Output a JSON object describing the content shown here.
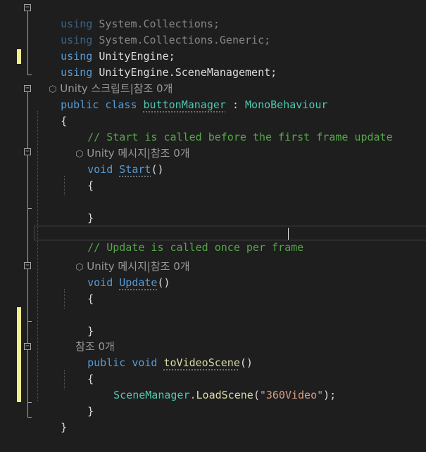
{
  "editor": {
    "lines": {
      "l1": {
        "kw": "using",
        "ns1": "System",
        "dot1": ".",
        "ns2": "Collections",
        "semi": ";"
      },
      "l2": {
        "kw": "using",
        "ns1": "System",
        "dot1": ".",
        "ns2": "Collections",
        "dot2": ".",
        "ns3": "Generic",
        "semi": ";"
      },
      "l3": {
        "kw": "using",
        "ns1": "UnityEngine",
        "semi": ";"
      },
      "l4": {
        "kw": "using",
        "ns1": "UnityEngine",
        "dot1": ".",
        "ns2": "SceneManagement",
        "semi": ";"
      },
      "l5": {
        "lens": "Unity 스크립트|참조 0개"
      },
      "l6": {
        "kw1": "public",
        "kw2": "class",
        "name": "buttonManager",
        "colon": " : ",
        "base": "MonoBehaviour"
      },
      "l7": {
        "text": "{"
      },
      "l8": {
        "comment": "// Start is called before the first frame update"
      },
      "l9": {
        "lens": "Unity 메시지|참조 0개"
      },
      "l10": {
        "kw": "void",
        "name": "Start",
        "parens": "()"
      },
      "l11": {
        "text": "{"
      },
      "l13": {
        "text": "}"
      },
      "l15": {
        "comment": "// Update is called once per frame"
      },
      "l16": {
        "lens": "Unity 메시지|참조 0개"
      },
      "l17": {
        "kw": "void",
        "name": "Update",
        "parens": "()"
      },
      "l18": {
        "text": "{"
      },
      "l20": {
        "text": "}"
      },
      "l21": {
        "lens": "참조 0개"
      },
      "l22": {
        "kw1": "public",
        "kw2": "void",
        "name": "toVideoScene",
        "parens": "()"
      },
      "l23": {
        "text": "{"
      },
      "l24": {
        "type": "SceneManager",
        "dot": ".",
        "method": "LoadScene",
        "open": "(",
        "str": "\"360Video\"",
        "close": ");"
      },
      "l25": {
        "text": "}"
      },
      "l26": {
        "text": "}"
      }
    },
    "colors": {
      "background": "#1e1e1e",
      "keyword": "#569cd6",
      "type": "#4ec9b0",
      "comment": "#57a64a",
      "string": "#d69d85",
      "change_bar": "#efef8c"
    },
    "fold_symbol": "−"
  }
}
